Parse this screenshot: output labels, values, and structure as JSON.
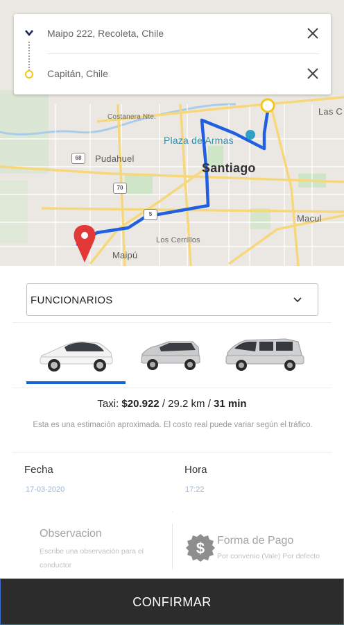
{
  "route": {
    "origin": "Maipo 222, Recoleta, Chile",
    "destination": "Capitán, Chile"
  },
  "map": {
    "labels": {
      "costanera": "Costanera Nte.",
      "pudahuel": "Pudahuel",
      "plaza": "Plaza de Armas",
      "santiago": "Santiago",
      "las_condes": "Las C",
      "macul": "Macul",
      "cerrillos": "Los Cerrillos",
      "maipu": "Maipú",
      "shield_68": "68",
      "shield_70": "70",
      "shield_5": "5"
    },
    "route_color": "#1f5fe0",
    "pin_color": "#e23838",
    "dest_marker_color": "#f5c518"
  },
  "service": {
    "selected": "FUNCIONARIOS"
  },
  "vehicles": {
    "selected_index": 0,
    "items": [
      "sedan",
      "hatchback",
      "van"
    ]
  },
  "fare": {
    "prefix": "Taxi: ",
    "price": "$20.922",
    "sep1": " / ",
    "distance": "29.2 km",
    "sep2": " / ",
    "duration": "31 min",
    "note": "Esta es una estimación aproximada. El costo real puede variar según el tráfico."
  },
  "schedule": {
    "date_label": "Fecha",
    "date_value": "17-03-2020",
    "time_label": "Hora",
    "time_value": "17:22"
  },
  "observation": {
    "title": "Observacion",
    "placeholder": "Escribe una observación para el conductor"
  },
  "payment": {
    "title": "Forma de Pago",
    "subtitle": "Por convenio (Vale) Por defecto"
  },
  "confirm_label": "CONFIRMAR"
}
